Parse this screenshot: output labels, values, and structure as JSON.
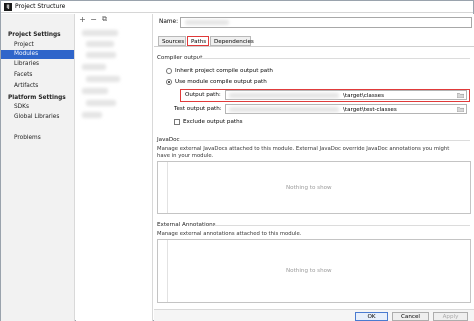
{
  "window": {
    "title": "Project Structure",
    "app_icon": "intellij-icon"
  },
  "sidebar": {
    "project_settings_header": "Project Settings",
    "project_settings_items": [
      {
        "label": "Project",
        "selected": false
      },
      {
        "label": "Modules",
        "selected": true
      },
      {
        "label": "Libraries",
        "selected": false
      },
      {
        "label": "Facets",
        "selected": false
      },
      {
        "label": "Artifacts",
        "selected": false
      }
    ],
    "platform_settings_header": "Platform Settings",
    "platform_settings_items": [
      {
        "label": "SDKs"
      },
      {
        "label": "Global Libraries"
      }
    ],
    "problems_label": "Problems"
  },
  "module_toolbar": {
    "add": "+",
    "remove": "−",
    "copy": "⧉"
  },
  "main": {
    "name_label": "Name:",
    "tabs": [
      {
        "label": "Sources",
        "active": false
      },
      {
        "label": "Paths",
        "active": true
      },
      {
        "label": "Dependencies",
        "active": false
      }
    ],
    "compiler_output": {
      "title": "Compiler output",
      "inherit_label": "Inherit project compile output path",
      "use_module_label": "Use module compile output path",
      "selected_option": "use_module",
      "output_path_label": "Output path:",
      "output_path_value": "\\target\\classes",
      "test_output_path_label": "Test output path:",
      "test_output_path_value": "\\target\\test-classes",
      "exclude_label": "Exclude output paths",
      "exclude_checked": false
    },
    "javadoc": {
      "title": "JavaDoc",
      "description": "Manage external JavaDocs attached to this module. External JavaDoc override JavaDoc annotations you might have in your module.",
      "empty_text": "Nothing to show"
    },
    "external_annotations": {
      "title": "External Annotations",
      "description": "Manage external annotations attached to this module.",
      "empty_text": "Nothing to show"
    }
  },
  "buttons": {
    "ok": "OK",
    "cancel": "Cancel",
    "apply": "Apply"
  },
  "colors": {
    "selection": "#2f65ca",
    "highlight_box": "#e03a3a"
  }
}
